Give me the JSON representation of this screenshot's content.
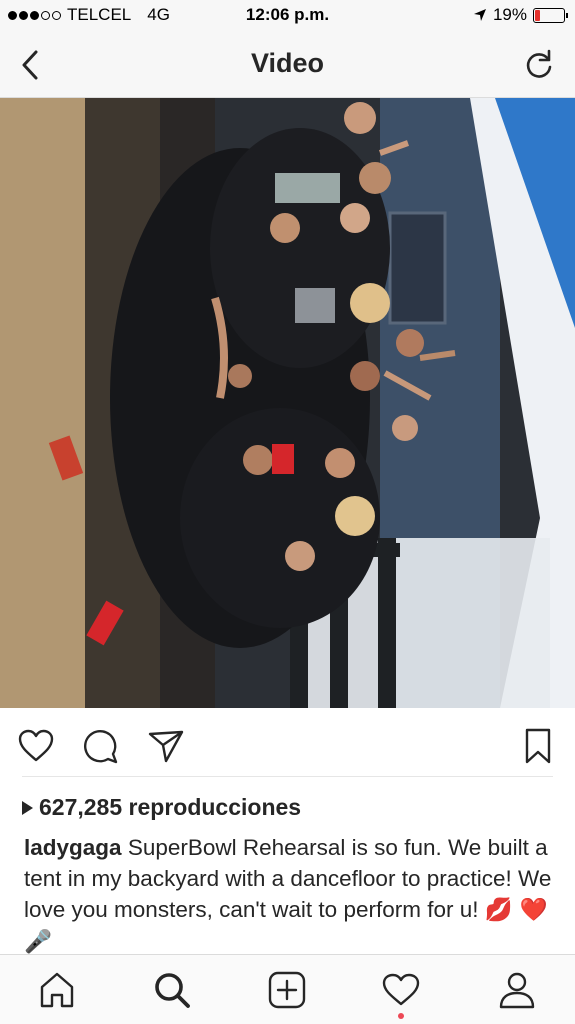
{
  "status_bar": {
    "carrier": "TELCEL",
    "network": "4G",
    "time": "12:06 p.m.",
    "battery_percent": "19%",
    "battery_level": 0.19,
    "signal_bars": 3,
    "signal_total": 5,
    "icons": [
      "location-arrow-icon",
      "battery-icon"
    ]
  },
  "nav": {
    "title": "Video",
    "back_icon": "chevron-left-icon",
    "refresh_icon": "refresh-icon"
  },
  "video": {
    "content": "group-photo-video"
  },
  "actions": {
    "icons": [
      "heart-icon",
      "comment-icon",
      "share-icon",
      "bookmark-icon"
    ]
  },
  "post": {
    "views_count": "627,285 reproducciones",
    "username": "ladygaga",
    "caption_text": "SuperBowl Rehearsal is so fun. We built a tent in my backyard with a dancefloor  to practice! We love you monsters, can't wait to perform for u!",
    "caption_emojis": "💋 ❤️ 🎤"
  },
  "tab_bar": {
    "icons": [
      "home-icon",
      "search-icon",
      "add-post-icon",
      "activity-heart-icon",
      "profile-icon"
    ],
    "active": "search-icon"
  },
  "colors": {
    "text": "#262626",
    "notification": "#ed4956",
    "battery_low": "#e5322d"
  }
}
